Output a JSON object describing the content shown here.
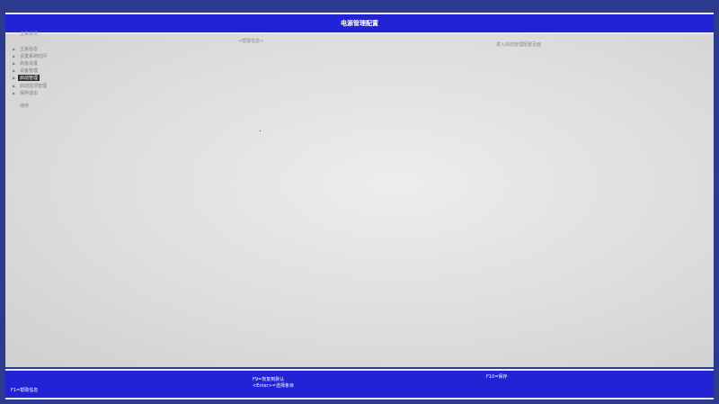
{
  "header": {
    "title": "电源管理配置"
  },
  "left_panel": {
    "section_title": "主菜单项",
    "menu_items": [
      {
        "label": "主板信息",
        "selected": false
      },
      {
        "label": "设置系统时间",
        "selected": false
      },
      {
        "label": "高级设置",
        "selected": false
      },
      {
        "label": "设备管理",
        "selected": false
      },
      {
        "label": "启动管理",
        "selected": true
      },
      {
        "label": "启动选项管理",
        "selected": false
      },
      {
        "label": "保存退出",
        "selected": false
      }
    ],
    "exit_label": "继续"
  },
  "help": {
    "heading": "<帮助信息>",
    "text": "进入启动管理配置页面"
  },
  "footer": {
    "f1": "F1=帮助信息",
    "f9": "F9=恢复到默认",
    "enter": "<Enter>=选择条目",
    "f10": "F10=保存"
  }
}
